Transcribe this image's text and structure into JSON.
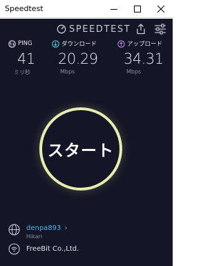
{
  "window": {
    "title": "Speedtest"
  },
  "header": {
    "brand": "SPEEDTEST"
  },
  "metrics": {
    "ping": {
      "label": "PING",
      "value": "41",
      "unit": "ミリ秒"
    },
    "download": {
      "label": "ダウンロード",
      "value": "20.29",
      "unit": "Mbps"
    },
    "upload": {
      "label": "アップロード",
      "value": "34.31",
      "unit": "Mbps"
    }
  },
  "start_button": {
    "label": "スタート"
  },
  "isp": {
    "name": "denpa893",
    "chevron": "›",
    "sub": "Hikari"
  },
  "server": {
    "name": "FreeBit Co.,Ltd."
  },
  "colors": {
    "background": "#141526",
    "ring": "#e8ecae",
    "download_accent": "#4fd0e0",
    "upload_accent": "#b98fe8",
    "isp_link": "#4fb6e8"
  }
}
